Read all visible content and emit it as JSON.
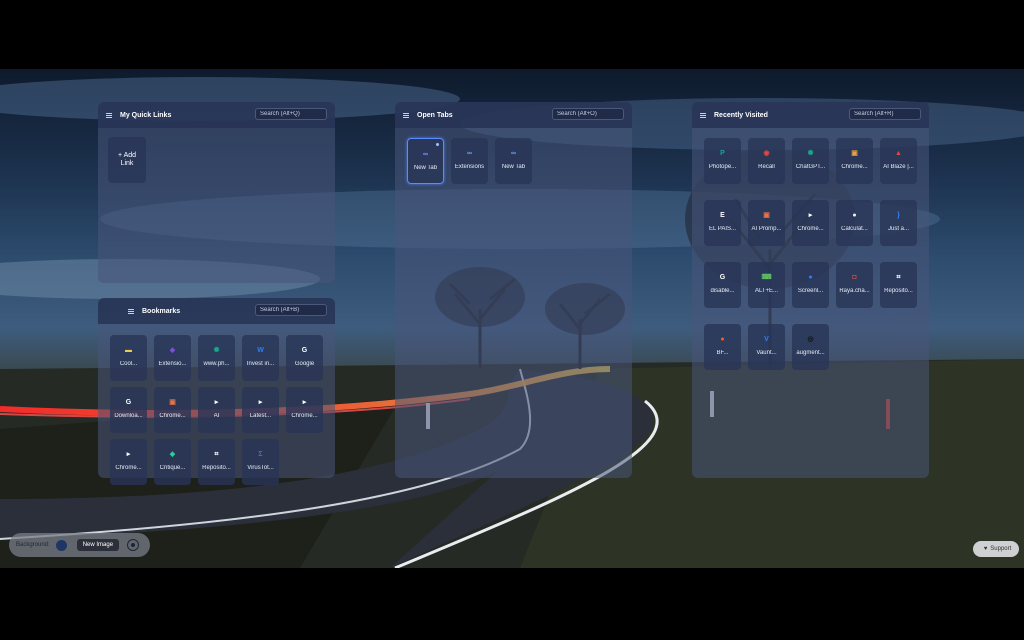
{
  "quick_links": {
    "title": "My Quick Links",
    "search_placeholder": "Search (Alt+Q)",
    "add_link_line1": "+ Add",
    "add_link_line2": "Link"
  },
  "bookmarks": {
    "title": "Bookmarks",
    "search_placeholder": "Search (Alt+B)",
    "items": [
      {
        "label": "Cool...",
        "icon": "folder-icon",
        "color": "#f2c94c"
      },
      {
        "label": "Extensio...",
        "icon": "extension-icon",
        "color": "#7b4fd6"
      },
      {
        "label": "www.ph...",
        "icon": "chatgpt-icon",
        "color": "#19a589"
      },
      {
        "label": "Invest in...",
        "icon": "chart-icon",
        "color": "#2d7ff9"
      },
      {
        "label": "Google",
        "icon": "google-icon",
        "color": "#ffffff"
      },
      {
        "label": "Downloa...",
        "icon": "google-icon",
        "color": "#ffffff"
      },
      {
        "label": "Chrome...",
        "icon": "image-icon",
        "color": "#e8734a"
      },
      {
        "label": "AI",
        "icon": "play-icon",
        "color": "#ffffff"
      },
      {
        "label": "Latest...",
        "icon": "play-icon",
        "color": "#ffffff"
      },
      {
        "label": "Chrome...",
        "icon": "play-icon",
        "color": "#ffffff"
      },
      {
        "label": "Chrome...",
        "icon": "play-icon",
        "color": "#ffffff"
      },
      {
        "label": "Critique...",
        "icon": "diamond-icon",
        "color": "#2ecc9a"
      },
      {
        "label": "Reposito...",
        "icon": "screenshot-icon",
        "color": "#ffffff"
      },
      {
        "label": "VirusTot...",
        "icon": "virustotal-icon",
        "color": "#3b6fd8"
      }
    ]
  },
  "open_tabs": {
    "title": "Open Tabs",
    "search_placeholder": "Search (Alt+O)",
    "items": [
      {
        "label": "New Tab",
        "icon": "link-icon",
        "color": "#6fa0ff",
        "active": true
      },
      {
        "label": "Extensions",
        "icon": "link-icon",
        "color": "#6fa0ff",
        "active": false
      },
      {
        "label": "New Tab",
        "icon": "link-icon",
        "color": "#6fa0ff",
        "active": false
      }
    ]
  },
  "recent": {
    "title": "Recently Visited",
    "search_placeholder": "Search (Alt+R)",
    "items": [
      {
        "label": "Photope...",
        "icon": "photopea-icon",
        "color": "#18a497"
      },
      {
        "label": "Recall",
        "icon": "recall-icon",
        "color": "#e04848"
      },
      {
        "label": "ChatGPT...",
        "icon": "chatgpt-icon",
        "color": "#19a589"
      },
      {
        "label": "Chrome...",
        "icon": "chrome-web-icon",
        "color": "#e8a040"
      },
      {
        "label": "AI Blaze |...",
        "icon": "blaze-icon",
        "color": "#e24a3b"
      },
      {
        "label": "EL PAÍS...",
        "icon": "elpais-icon",
        "color": "#ffffff"
      },
      {
        "label": "AI Promp...",
        "icon": "image-icon",
        "color": "#e8734a"
      },
      {
        "label": "Chrome...",
        "icon": "play-icon",
        "color": "#ffffff"
      },
      {
        "label": "Calculat...",
        "icon": "calculator-icon",
        "color": "#f0f0f0"
      },
      {
        "label": "Just a...",
        "icon": "bracket-icon",
        "color": "#3b82f6"
      },
      {
        "label": "disable...",
        "icon": "google-icon",
        "color": "#ffffff"
      },
      {
        "label": "ALT+E...",
        "icon": "keyboard-icon",
        "color": "#5fbf62"
      },
      {
        "label": "Screenl...",
        "icon": "circle-icon",
        "color": "#2d7ff9"
      },
      {
        "label": "Raya.cha...",
        "icon": "raya-icon",
        "color": "#e24a3b"
      },
      {
        "label": "Reposito...",
        "icon": "screenshot-icon",
        "color": "#ffffff"
      },
      {
        "label": "BF...",
        "icon": "reddit-icon",
        "color": "#ff5a1f"
      },
      {
        "label": "Vaunt...",
        "icon": "vaunt-icon",
        "color": "#2d7ff9"
      },
      {
        "label": "augment...",
        "icon": "augment-icon",
        "color": "#111111"
      }
    ]
  },
  "background_bar": {
    "label": "Background:",
    "button": "New Image",
    "color": "#1e3566"
  },
  "support": {
    "label": "Support"
  }
}
